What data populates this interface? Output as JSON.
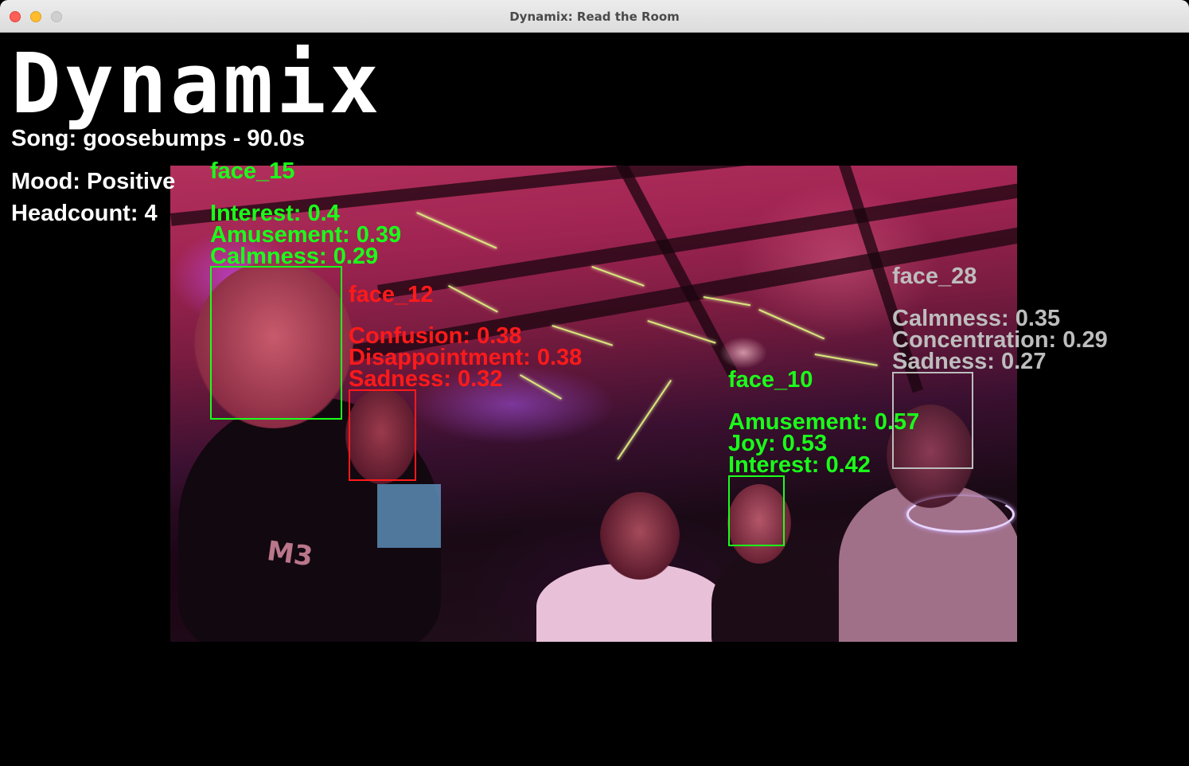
{
  "window": {
    "title": "Dynamix: Read the Room"
  },
  "app": {
    "logo": "Dynamix",
    "song_line": "Song: goosebumps - 90.0s",
    "mood_line": "Mood: Positive",
    "headcount_line": "Headcount: 4"
  },
  "faces": [
    {
      "id": "face_15",
      "color": "#1aff1a",
      "emotions": [
        "Interest: 0.4",
        "Amusement: 0.39",
        "Calmness: 0.29"
      ]
    },
    {
      "id": "face_12",
      "color": "#ff1a1a",
      "emotions": [
        "Confusion: 0.38",
        "Disappointment: 0.38",
        "Sadness: 0.32"
      ]
    },
    {
      "id": "face_10",
      "color": "#1aff1a",
      "emotions": [
        "Amusement: 0.57",
        "Joy: 0.53",
        "Interest: 0.42"
      ]
    },
    {
      "id": "face_28",
      "color": "#bdbdbd",
      "emotions": [
        "Calmness: 0.35",
        "Concentration: 0.29",
        "Sadness: 0.27"
      ]
    }
  ]
}
